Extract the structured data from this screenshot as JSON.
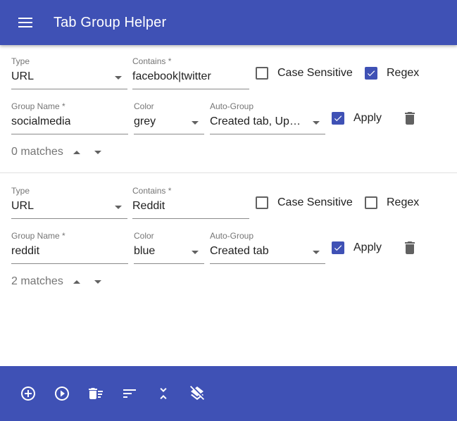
{
  "app": {
    "title": "Tab Group Helper"
  },
  "colors": {
    "primary": "#3f51b5",
    "on_primary": "#ffffff",
    "label": "#757575",
    "icon": "#616161"
  },
  "rules": [
    {
      "type_label": "Type",
      "type_value": "URL",
      "contains_label": "Contains *",
      "contains_value": "facebook|twitter",
      "case_sensitive_label": "Case Sensitive",
      "case_sensitive": false,
      "regex_label": "Regex",
      "regex": true,
      "group_name_label": "Group Name *",
      "group_name_value": "socialmedia",
      "color_label": "Color",
      "color_value": "grey",
      "auto_group_label": "Auto-Group",
      "auto_group_value": "Created tab, Up…",
      "apply_label": "Apply",
      "apply": true,
      "matches_text": "0 matches"
    },
    {
      "type_label": "Type",
      "type_value": "URL",
      "contains_label": "Contains *",
      "contains_value": "Reddit",
      "case_sensitive_label": "Case Sensitive",
      "case_sensitive": false,
      "regex_label": "Regex",
      "regex": false,
      "group_name_label": "Group Name *",
      "group_name_value": "reddit",
      "color_label": "Color",
      "color_value": "blue",
      "auto_group_label": "Auto-Group",
      "auto_group_value": "Created tab",
      "apply_label": "Apply",
      "apply": true,
      "matches_text": "2 matches"
    }
  ],
  "bottom_toolbar": {
    "icons": [
      "add-circle-icon",
      "play-circle-icon",
      "delete-sweep-icon",
      "sort-icon",
      "collapse-icon",
      "layers-clear-icon"
    ]
  }
}
